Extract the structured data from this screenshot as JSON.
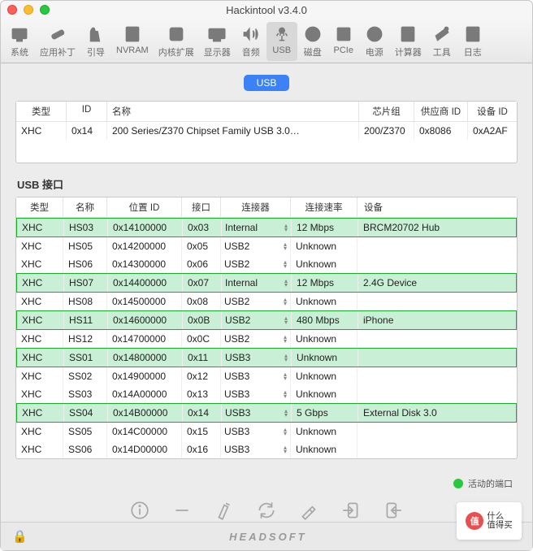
{
  "window": {
    "title": "Hackintool v3.4.0"
  },
  "toolbar": {
    "items": [
      {
        "label": "系统"
      },
      {
        "label": "应用补丁"
      },
      {
        "label": "引导"
      },
      {
        "label": "NVRAM"
      },
      {
        "label": "内核扩展"
      },
      {
        "label": "显示器"
      },
      {
        "label": "音频"
      },
      {
        "label": "USB"
      },
      {
        "label": "磁盘"
      },
      {
        "label": "PCIe"
      },
      {
        "label": "电源"
      },
      {
        "label": "计算器"
      },
      {
        "label": "工具"
      },
      {
        "label": "日志"
      }
    ],
    "active_index": 7
  },
  "pill": "USB",
  "controllers": {
    "headers": [
      "类型",
      "ID",
      "名称",
      "芯片组",
      "供应商 ID",
      "设备 ID"
    ],
    "rows": [
      {
        "type": "XHC",
        "id": "0x14",
        "name": "200 Series/Z370 Chipset Family USB 3.0…",
        "chipset": "200/Z370",
        "vendor": "0x8086",
        "device": "0xA2AF"
      }
    ]
  },
  "ports_title": "USB 接口",
  "ports": {
    "headers": [
      "类型",
      "名称",
      "位置 ID",
      "接口",
      "连接器",
      "连接速率",
      "设备"
    ],
    "rows": [
      {
        "type": "XHC",
        "name": "HS03",
        "loc": "0x14100000",
        "port": "0x03",
        "conn": "Internal",
        "speed": "12 Mbps",
        "dev": "BRCM20702 Hub",
        "hl": true
      },
      {
        "type": "XHC",
        "name": "HS05",
        "loc": "0x14200000",
        "port": "0x05",
        "conn": "USB2",
        "speed": "Unknown",
        "dev": ""
      },
      {
        "type": "XHC",
        "name": "HS06",
        "loc": "0x14300000",
        "port": "0x06",
        "conn": "USB2",
        "speed": "Unknown",
        "dev": ""
      },
      {
        "type": "XHC",
        "name": "HS07",
        "loc": "0x14400000",
        "port": "0x07",
        "conn": "Internal",
        "speed": "12 Mbps",
        "dev": "2.4G Device",
        "hl": true
      },
      {
        "type": "XHC",
        "name": "HS08",
        "loc": "0x14500000",
        "port": "0x08",
        "conn": "USB2",
        "speed": "Unknown",
        "dev": ""
      },
      {
        "type": "XHC",
        "name": "HS11",
        "loc": "0x14600000",
        "port": "0x0B",
        "conn": "USB2",
        "speed": "480 Mbps",
        "dev": "iPhone",
        "hl": true
      },
      {
        "type": "XHC",
        "name": "HS12",
        "loc": "0x14700000",
        "port": "0x0C",
        "conn": "USB2",
        "speed": "Unknown",
        "dev": ""
      },
      {
        "type": "XHC",
        "name": "SS01",
        "loc": "0x14800000",
        "port": "0x11",
        "conn": "USB3",
        "speed": "Unknown",
        "dev": "",
        "hl": true
      },
      {
        "type": "XHC",
        "name": "SS02",
        "loc": "0x14900000",
        "port": "0x12",
        "conn": "USB3",
        "speed": "Unknown",
        "dev": ""
      },
      {
        "type": "XHC",
        "name": "SS03",
        "loc": "0x14A00000",
        "port": "0x13",
        "conn": "USB3",
        "speed": "Unknown",
        "dev": ""
      },
      {
        "type": "XHC",
        "name": "SS04",
        "loc": "0x14B00000",
        "port": "0x14",
        "conn": "USB3",
        "speed": "5 Gbps",
        "dev": "External Disk 3.0",
        "hl": true
      },
      {
        "type": "XHC",
        "name": "SS05",
        "loc": "0x14C00000",
        "port": "0x15",
        "conn": "USB3",
        "speed": "Unknown",
        "dev": ""
      },
      {
        "type": "XHC",
        "name": "SS06",
        "loc": "0x14D00000",
        "port": "0x16",
        "conn": "USB3",
        "speed": "Unknown",
        "dev": ""
      }
    ]
  },
  "legend": "活动的端口",
  "brand": "HEADSOFT",
  "watermark": "值 什么值得买"
}
